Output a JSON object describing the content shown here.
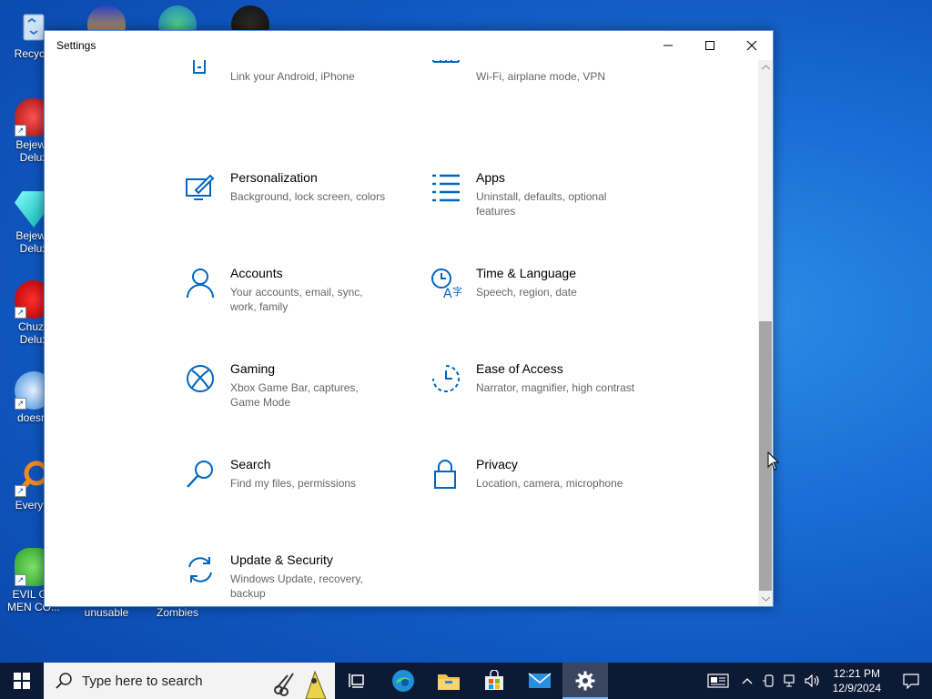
{
  "desktop": {
    "icons": [
      {
        "label": "Recycle"
      },
      {
        "label": "Bejewe\nDelux"
      },
      {
        "label": "Bejewe\nDelux"
      },
      {
        "label": "Chuzz\nDelux"
      },
      {
        "label": "doesnt"
      },
      {
        "label": "Everyth"
      },
      {
        "label": "EVIL GR\nMEN CO..."
      },
      {
        "label": "unusable"
      },
      {
        "label": "Zombies"
      }
    ]
  },
  "window": {
    "title": "Settings",
    "tiles": [
      {
        "name": "",
        "desc": "Link your Android, iPhone",
        "icon": "phone-icon"
      },
      {
        "name": "",
        "desc": "Wi-Fi, airplane mode, VPN",
        "icon": "globe-icon"
      },
      {
        "name": "Personalization",
        "desc": "Background, lock screen, colors",
        "icon": "personalization-icon"
      },
      {
        "name": "Apps",
        "desc": "Uninstall, defaults, optional features",
        "icon": "apps-icon"
      },
      {
        "name": "Accounts",
        "desc": "Your accounts, email, sync, work, family",
        "icon": "person-icon"
      },
      {
        "name": "Time & Language",
        "desc": "Speech, region, date",
        "icon": "time-language-icon"
      },
      {
        "name": "Gaming",
        "desc": "Xbox Game Bar, captures, Game Mode",
        "icon": "xbox-icon"
      },
      {
        "name": "Ease of Access",
        "desc": "Narrator, magnifier, high contrast",
        "icon": "ease-of-access-icon"
      },
      {
        "name": "Search",
        "desc": "Find my files, permissions",
        "icon": "search-icon"
      },
      {
        "name": "Privacy",
        "desc": "Location, camera, microphone",
        "icon": "lock-icon"
      },
      {
        "name": "Update & Security",
        "desc": "Windows Update, recovery, backup",
        "icon": "sync-icon"
      }
    ]
  },
  "taskbar": {
    "search_placeholder": "Type here to search",
    "time": "12:21 PM",
    "date": "12/9/2024"
  },
  "colors": {
    "accent": "#0067c0",
    "taskbar": "#0c1a36"
  }
}
